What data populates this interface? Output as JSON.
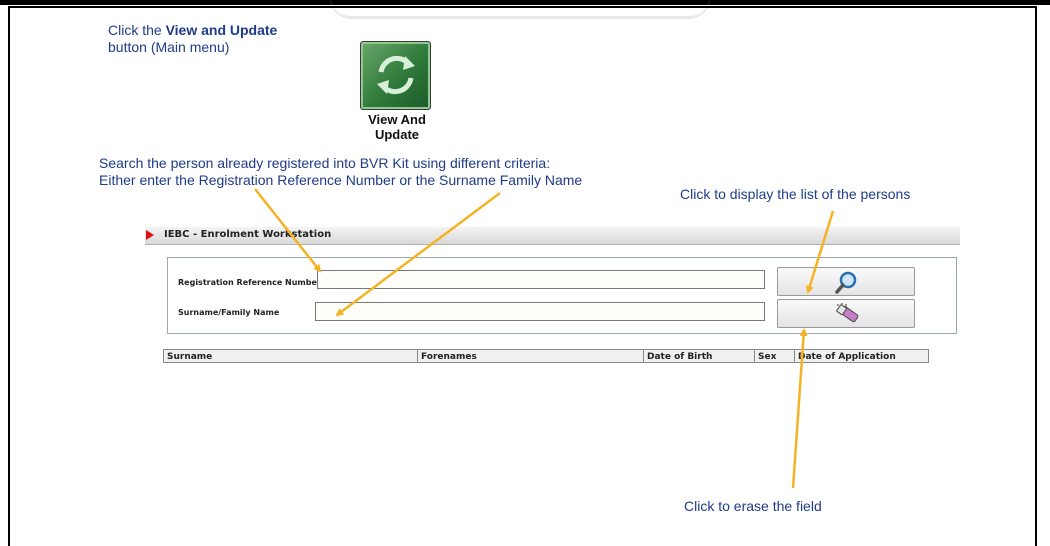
{
  "instructions": {
    "main_menu_prefix": "Click the ",
    "main_menu_bold": "View and Update",
    "main_menu_suffix": "button (Main menu)",
    "search_line1": "Search the person already registered into BVR Kit using different criteria:",
    "search_line2": "Either enter the Registration Reference Number or the Surname Family Name",
    "display_list": "Click to display the list of the persons",
    "erase_field": "Click to erase the field"
  },
  "view_update_button": {
    "label_line1": "View And",
    "label_line2": "Update",
    "icon": "refresh-icon"
  },
  "window": {
    "title": "IEBC - Enrolment Workstation"
  },
  "form": {
    "registration_label": "Registration Reference Number",
    "registration_value": "",
    "surname_label": "Surname/Family Name",
    "surname_value": "",
    "search_button_icon": "magnifier-icon",
    "clear_button_icon": "eraser-icon"
  },
  "results_table": {
    "columns": [
      "Surname",
      "Forenames",
      "Date of Birth",
      "Sex",
      "Date of Application"
    ]
  },
  "colors": {
    "instruction_text": "#1f3b8a",
    "arrow": "#f5b324",
    "button_green": "#2e7a3a"
  }
}
